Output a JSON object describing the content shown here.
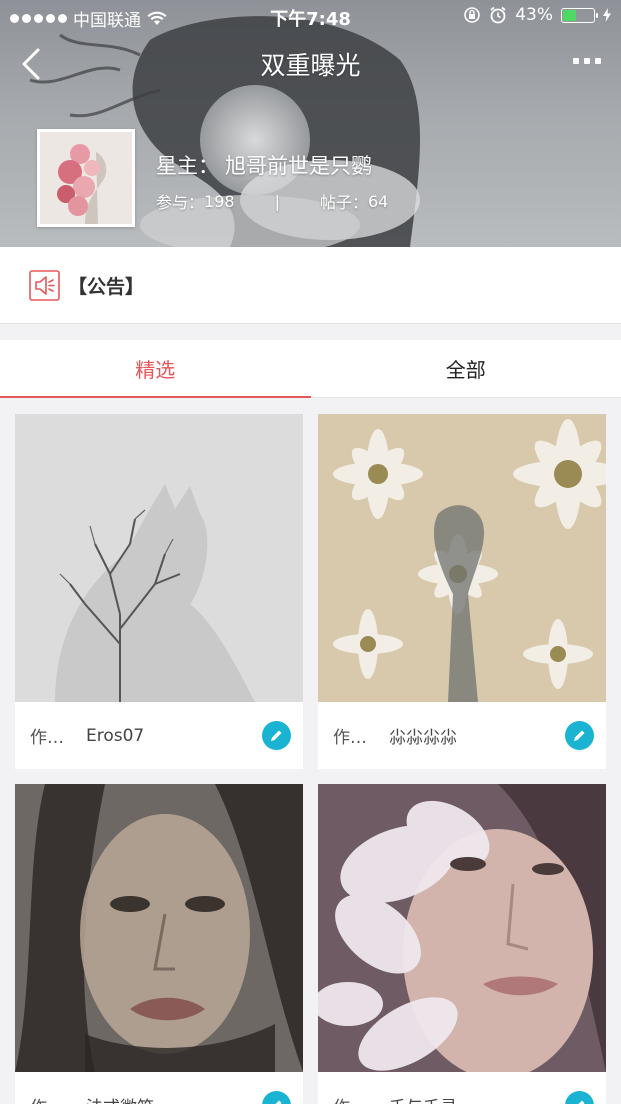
{
  "status_bar": {
    "carrier": "中国联通",
    "time": "下午7:48",
    "battery": "43%"
  },
  "nav": {
    "title": "双重曝光"
  },
  "group": {
    "owner_label": "星主：",
    "owner_name": "旭哥前世是只鹦",
    "members_label": "参与：",
    "members_count": "198",
    "divider": "|",
    "posts_label": "帖子：",
    "posts_count": "64"
  },
  "announcement": {
    "text": "【公告】"
  },
  "tabs": [
    {
      "label": "精选",
      "active": true
    },
    {
      "label": "全部",
      "active": false
    }
  ],
  "posts": [
    {
      "author_label": "作…",
      "author": "Eros07"
    },
    {
      "author_label": "作…",
      "author": "尛尛尛尛"
    },
    {
      "author_label": "作…",
      "author": "法式微笑"
    },
    {
      "author_label": "作…",
      "author": "千与千寻"
    }
  ],
  "colors": {
    "accent": "#e5575a",
    "edit_button": "#1ab4d2"
  }
}
